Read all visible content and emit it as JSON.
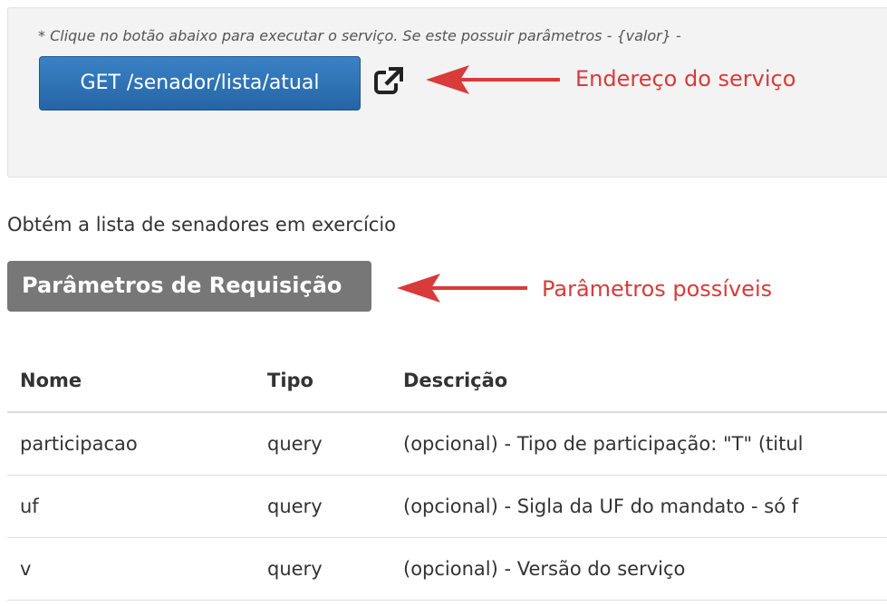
{
  "service": {
    "hint": "* Clique no botão abaixo para executar o serviço. Se este possuir parâmetros - {valor} -",
    "button_label": "GET /senador/lista/atual",
    "external_icon": "external-link-icon",
    "description": "Obtém a lista de senadores em exercício"
  },
  "params": {
    "badge": "Parâmetros de Requisição",
    "columns": [
      "Nome",
      "Tipo",
      "Descrição"
    ],
    "rows": [
      {
        "nome": "participacao",
        "tipo": "query",
        "descricao": "(opcional) - Tipo de participação: \"T\" (titul"
      },
      {
        "nome": "uf",
        "tipo": "query",
        "descricao": "(opcional) - Sigla da UF do mandato - só f"
      },
      {
        "nome": "v",
        "tipo": "query",
        "descricao": "(opcional) - Versão do serviço"
      }
    ]
  },
  "annotations": {
    "endpoint": "Endereço do serviço",
    "params": "Parâmetros possíveis",
    "color": "#d93a3a"
  },
  "colors": {
    "button": "#2c6fb3",
    "badge": "#777777",
    "well": "#f3f3f3"
  }
}
